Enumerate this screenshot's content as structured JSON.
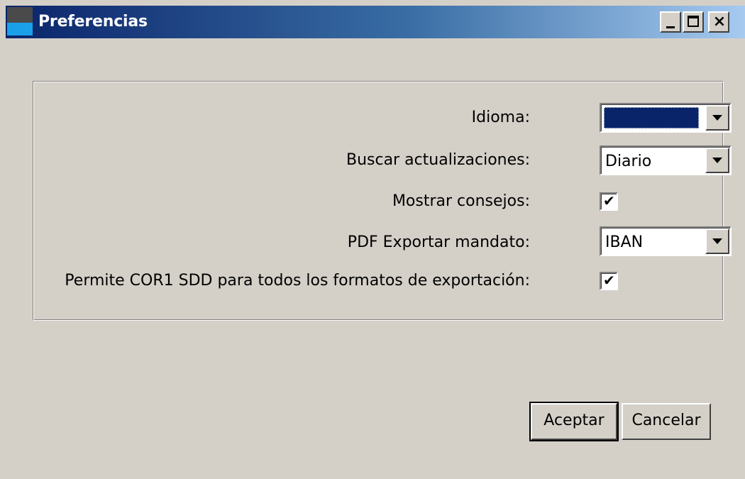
{
  "window": {
    "title": "Preferencias",
    "controls": {
      "minimize_icon": "minimize-icon",
      "maximize_icon": "maximize-icon",
      "close_icon": "close-icon",
      "minimize_glyph": "_",
      "close_glyph": "×"
    }
  },
  "settings": {
    "language": {
      "label": "Idioma:",
      "value": ""
    },
    "updates": {
      "label": "Buscar actualizaciones:",
      "value": "Diario"
    },
    "tips": {
      "label": "Mostrar consejos:",
      "checked": true,
      "mark": "✔"
    },
    "pdf_export": {
      "label": "PDF Exportar mandato:",
      "value": "IBAN"
    },
    "cor1": {
      "label": "Permite COR1 SDD para todos los formatos de exportación:",
      "checked": true,
      "mark": "✔"
    }
  },
  "buttons": {
    "accept": "Aceptar",
    "cancel": "Cancelar"
  },
  "colors": {
    "titlebar_start": "#0a246a",
    "titlebar_end": "#a6caf0",
    "face": "#d4d0c8",
    "selection": "#0a246a"
  }
}
